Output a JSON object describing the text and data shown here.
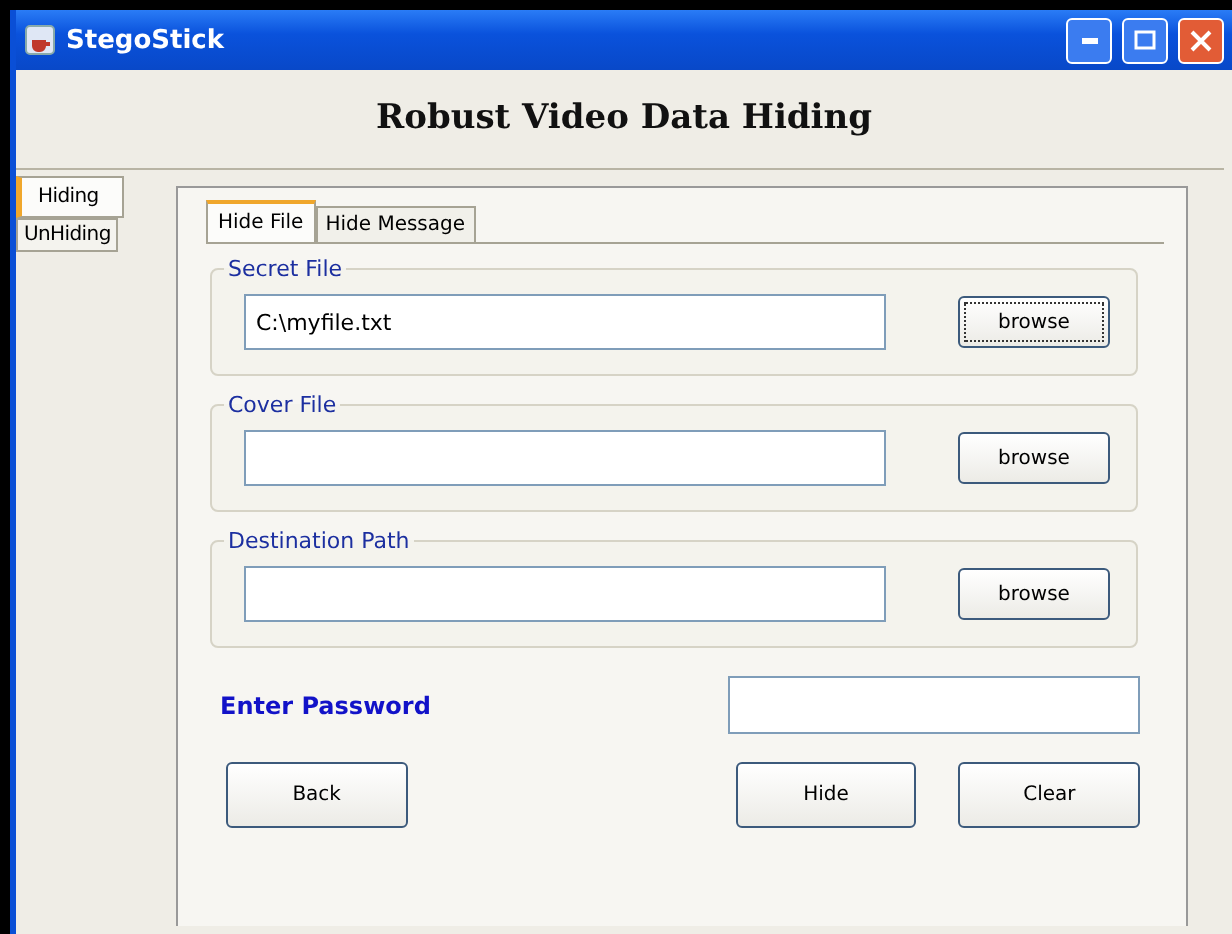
{
  "window": {
    "title": "StegoStick"
  },
  "heading": "Robust Video Data Hiding",
  "side_tabs": [
    {
      "label": "Hiding",
      "selected": true
    },
    {
      "label": "UnHiding",
      "selected": false
    }
  ],
  "inner_tabs": [
    {
      "label": "Hide File",
      "selected": true
    },
    {
      "label": "Hide Message",
      "selected": false
    }
  ],
  "groups": [
    {
      "title": "Secret File",
      "value": "C:\\myfile.txt",
      "button": "browse",
      "focused": true
    },
    {
      "title": "Cover File",
      "button": "browse",
      "focused": false
    },
    {
      "title": "Destination Path",
      "button": "browse",
      "focused": false
    }
  ],
  "password": {
    "label": "Enter Password"
  },
  "buttons": [
    "Back",
    "Hide",
    "Clear"
  ]
}
